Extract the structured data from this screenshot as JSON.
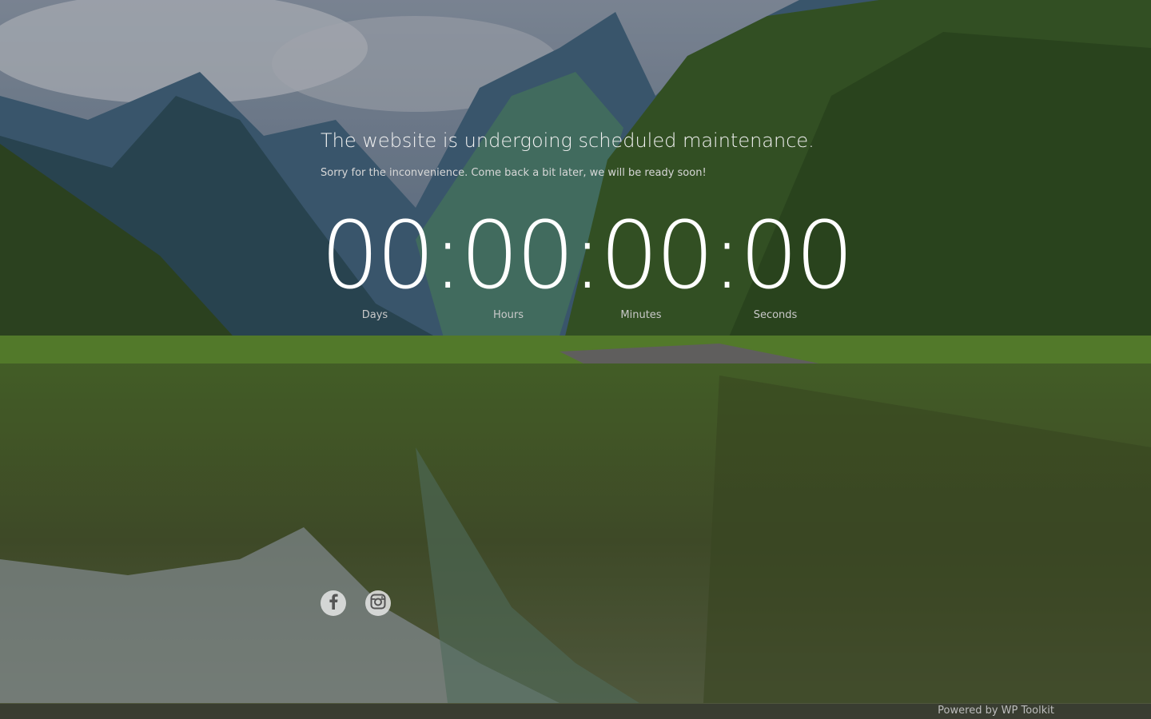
{
  "maintenance": {
    "title": "The website is undergoing scheduled maintenance.",
    "subtitle": "Sorry for the inconvenience. Come back a bit later, we will be ready soon!"
  },
  "countdown": {
    "display": "00:00:00:00",
    "labels": {
      "days": "Days",
      "hours": "Hours",
      "minutes": "Minutes",
      "seconds": "Seconds"
    }
  },
  "social": {
    "icons": [
      "facebook-icon",
      "instagram-icon"
    ]
  },
  "footer": {
    "powered_prefix": "Powered by",
    "powered_link": "WP Toolkit"
  }
}
